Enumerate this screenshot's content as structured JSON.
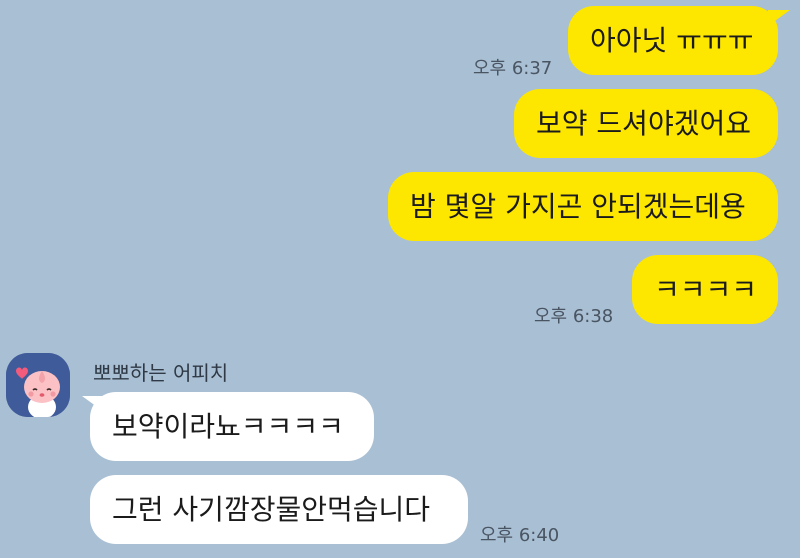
{
  "messages_me": [
    {
      "text": "아아닛 ㅠㅠㅠ",
      "time": "오후 6:37"
    },
    {
      "text": "보약 드셔야겠어요"
    },
    {
      "text": "밤 몇알 가지곤 안되겠는데용"
    },
    {
      "text": "ㅋㅋㅋㅋ",
      "time": "오후 6:38"
    }
  ],
  "sender": {
    "name": "뽀뽀하는 어피치",
    "avatar_icon": "apeach-character-icon"
  },
  "messages_other": [
    {
      "text": "보약이라뇨ㅋㅋㅋㅋ"
    },
    {
      "text": "그런 사기깜장물안먹습니다",
      "time": "오후 6:40"
    }
  ],
  "colors": {
    "background": "#a9bfd3",
    "my_bubble": "#fde600",
    "other_bubble": "#ffffff"
  }
}
